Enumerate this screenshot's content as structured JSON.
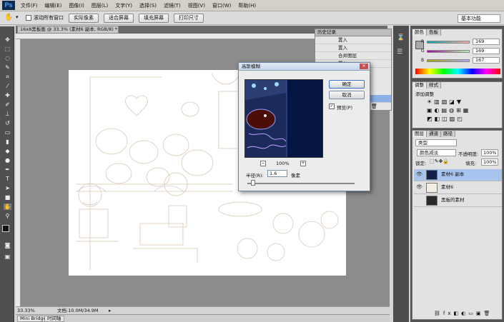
{
  "app": {
    "logo": "Ps",
    "workspace": "基本功能"
  },
  "menu": [
    "文件(F)",
    "编辑(E)",
    "图像(I)",
    "图层(L)",
    "文字(Y)",
    "选择(S)",
    "滤镜(T)",
    "视图(V)",
    "窗口(W)",
    "帮助(H)"
  ],
  "options": {
    "scroll_all": "滚动所有窗口",
    "actual_pixels": "实际像素",
    "fit_screen": "适合屏幕",
    "fill_screen": "填充屏幕",
    "print_size": "打印尺寸"
  },
  "document": {
    "tab_title": "16x8黑板画 @ 33.3% (素材6 副本, RGB/8) *"
  },
  "status": {
    "zoom": "33.33%",
    "doc_size": "文档:10.0M/34.9M"
  },
  "bottom_tabs": [
    "Mini Bridge",
    "时间轴"
  ],
  "history": {
    "title": "历史记录",
    "items": [
      "置入",
      "置入",
      "合并图层",
      "置入"
    ]
  },
  "color_panel": {
    "tabs": [
      "颜色",
      "色板"
    ],
    "r": "169",
    "g": "169",
    "b": "167"
  },
  "adjust_panel": {
    "tabs": [
      "调整",
      "样式"
    ],
    "label": "添加调整"
  },
  "layers_panel": {
    "tabs": [
      "图层",
      "通道",
      "路径"
    ],
    "kind": "类型",
    "blend_mode": "颜色减淡",
    "opacity_label": "不透明度:",
    "opacity": "100%",
    "lock_label": "锁定:",
    "fill_label": "填充:",
    "fill": "100%",
    "layers": [
      {
        "name": "素材6 副本"
      },
      {
        "name": "素材6"
      },
      {
        "name": "黑板的素材"
      }
    ]
  },
  "dialog": {
    "title": "高斯模糊",
    "ok": "确定",
    "cancel": "取消",
    "preview_label": "预览(P)",
    "zoom": "100%",
    "radius_label": "半径(R):",
    "radius_value": "1.6",
    "unit": "像素"
  },
  "colors": {
    "accent": "#3b6fd0",
    "dark_ui": "#535353",
    "preview_bg": "#061642"
  }
}
